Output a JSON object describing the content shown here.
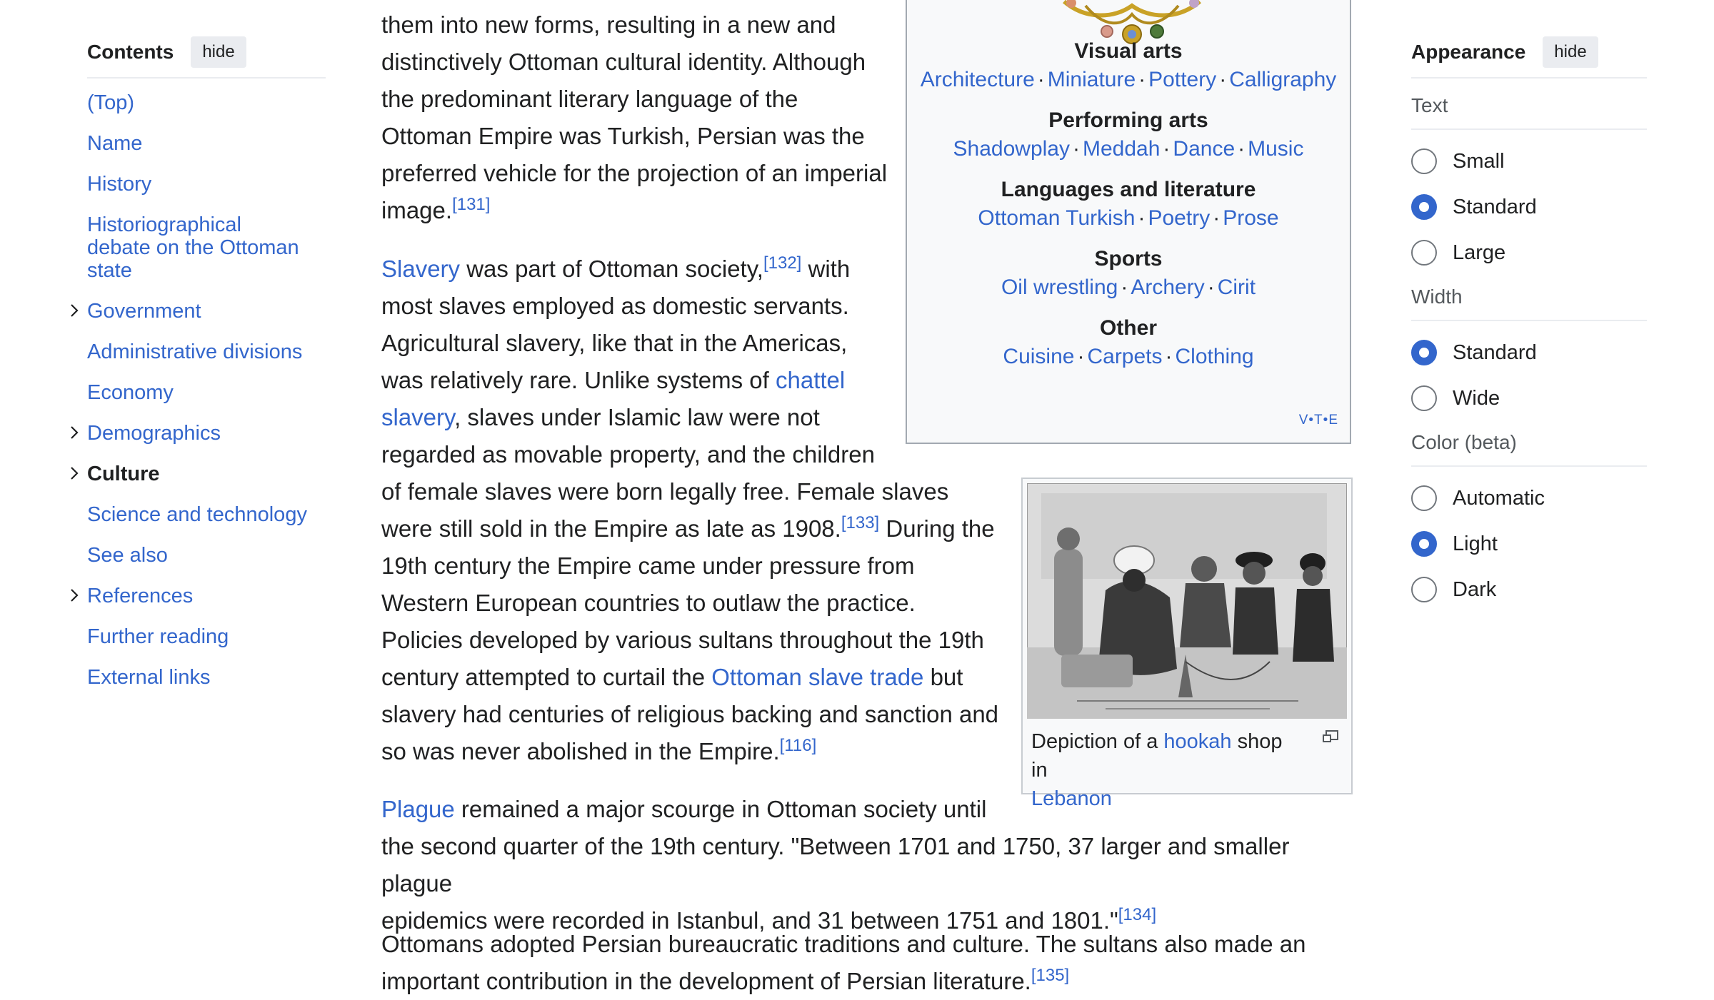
{
  "toc": {
    "title": "Contents",
    "hide_label": "hide",
    "items": [
      {
        "label": "(Top)"
      },
      {
        "label": "Name"
      },
      {
        "label": "History"
      },
      {
        "label": "Historiographical debate on the Ottoman state"
      },
      {
        "label": "Government"
      },
      {
        "label": "Administrative divisions"
      },
      {
        "label": "Economy"
      },
      {
        "label": "Demographics"
      },
      {
        "label": "Culture"
      },
      {
        "label": "Science and technology"
      },
      {
        "label": "See also"
      },
      {
        "label": "References"
      },
      {
        "label": "Further reading"
      },
      {
        "label": "External links"
      }
    ]
  },
  "article": {
    "p1": {
      "l1": "them into new forms, resulting in a new and",
      "l2": "distinctively Ottoman cultural identity. Although",
      "l3": "the predominant literary language of the",
      "l4": "Ottoman Empire was Turkish, Persian was the",
      "l5": "preferred vehicle for the projection of an imperial",
      "l6": "image.",
      "ref": "[131]"
    },
    "p2": {
      "link_slavery": "Slavery",
      "t1": " was part of Ottoman society,",
      "ref132": "[132]",
      "t2": " with",
      "l2": "most slaves employed as domestic servants.",
      "l3": "Agricultural slavery, like that in the Americas,",
      "l4a": "was relatively rare. Unlike systems of ",
      "link_chattel_1": "chattel",
      "link_chattel_2": "slavery",
      "l5b": ", slaves under Islamic law were not",
      "l6": "regarded as movable property, and the children",
      "l7": "of female slaves were born legally free. Female slaves",
      "l8a": "were still sold in the Empire as late as 1908.",
      "ref133": "[133]",
      "l8b": " During the",
      "l9": "19th century the Empire came under pressure from",
      "l10": "Western European countries to outlaw the practice.",
      "l11": "Policies developed by various sultans throughout the 19th",
      "l12a": "century attempted to curtail the ",
      "link_trade": "Ottoman slave trade",
      "l12b": " but",
      "l13": "slavery had centuries of religious backing and sanction and",
      "l14": "so was never abolished in the Empire.",
      "ref116": "[116]"
    },
    "p3": {
      "link_plague": "Plague",
      "l1": " remained a major scourge in Ottoman society until",
      "l2": "the second quarter of the 19th century. \"Between 1701 and 1750, 37 larger and smaller plague",
      "l3": "epidemics were recorded in Istanbul, and 31 between 1751 and 1801.\"",
      "ref134": "[134]"
    },
    "p4": {
      "l1": "Ottomans adopted Persian bureaucratic traditions and culture. The sultans also made an",
      "l2": "important contribution in the development of Persian literature.",
      "ref135": "[135]"
    }
  },
  "navbox": {
    "groups": [
      {
        "heading": "Visual arts",
        "links": [
          "Architecture",
          "Miniature",
          "Pottery",
          "Calligraphy"
        ]
      },
      {
        "heading": "Performing arts",
        "links": [
          "Shadowplay",
          "Meddah",
          "Dance",
          "Music"
        ]
      },
      {
        "heading": "Languages and literature",
        "links": [
          "Ottoman Turkish",
          "Poetry",
          "Prose"
        ]
      },
      {
        "heading": "Sports",
        "links": [
          "Oil wrestling",
          "Archery",
          "Cirit"
        ]
      },
      {
        "heading": "Other",
        "links": [
          "Cuisine",
          "Carpets",
          "Clothing"
        ]
      }
    ],
    "separator": "·",
    "vte": {
      "v": "V",
      "t": "T",
      "e": "E",
      "dot": "•"
    }
  },
  "figure": {
    "caption_a": "Depiction of a ",
    "caption_link1": "hookah",
    "caption_b": " shop in",
    "caption_link2": "Lebanon"
  },
  "appearance": {
    "title": "Appearance",
    "hide_label": "hide",
    "sections": [
      {
        "label": "Text",
        "options": [
          {
            "label": "Small",
            "selected": false
          },
          {
            "label": "Standard",
            "selected": true
          },
          {
            "label": "Large",
            "selected": false
          }
        ]
      },
      {
        "label": "Width",
        "options": [
          {
            "label": "Standard",
            "selected": true
          },
          {
            "label": "Wide",
            "selected": false
          }
        ]
      },
      {
        "label": "Color (beta)",
        "options": [
          {
            "label": "Automatic",
            "selected": false
          },
          {
            "label": "Light",
            "selected": true
          },
          {
            "label": "Dark",
            "selected": false
          }
        ]
      }
    ]
  },
  "colors": {
    "link": "#3366cc",
    "text": "#202122",
    "radio_selected": "#3366cc",
    "navbox_bg": "#f8f9fa"
  }
}
